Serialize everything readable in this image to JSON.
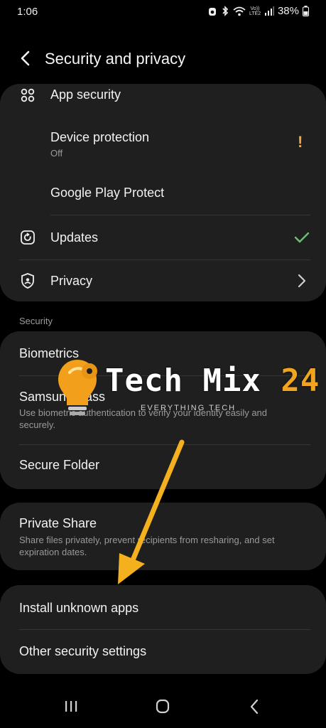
{
  "status_bar": {
    "time": "1:06",
    "carrier_small": "Vo)) LTE2",
    "battery": "38%"
  },
  "header": {
    "title": "Security and privacy"
  },
  "top_card": {
    "app_security": {
      "label": "App security",
      "icon": "apps-grid-icon"
    },
    "device_protection": {
      "label": "Device protection",
      "sub": "Off",
      "alert": "!"
    },
    "google_play_protect": {
      "label": "Google Play Protect"
    },
    "updates": {
      "label": "Updates",
      "icon": "update-icon"
    },
    "privacy": {
      "label": "Privacy",
      "icon": "privacy-shield-icon"
    }
  },
  "security_section": {
    "label": "Security",
    "biometrics": {
      "label": "Biometrics"
    },
    "samsung_pass": {
      "label": "Samsung Pass",
      "sub": "Use biometric authentication to verify your identity easily and securely."
    },
    "secure_folder": {
      "label": "Secure Folder"
    }
  },
  "private_share": {
    "label": "Private Share",
    "sub": "Share files privately, prevent recipients from resharing, and set expiration dates."
  },
  "bottom_card": {
    "install_unknown_apps": {
      "label": "Install unknown apps"
    },
    "other_security_settings": {
      "label": "Other security settings"
    }
  },
  "watermark": {
    "brand_text": "Tech Mix",
    "brand_number": "24",
    "tagline": "EVERYTHING TECH"
  },
  "colors": {
    "background": "#000000",
    "card": "#1f1f1f",
    "alert": "#f3a43a",
    "check": "#6fbf73",
    "arrow": "#f5b01d"
  }
}
